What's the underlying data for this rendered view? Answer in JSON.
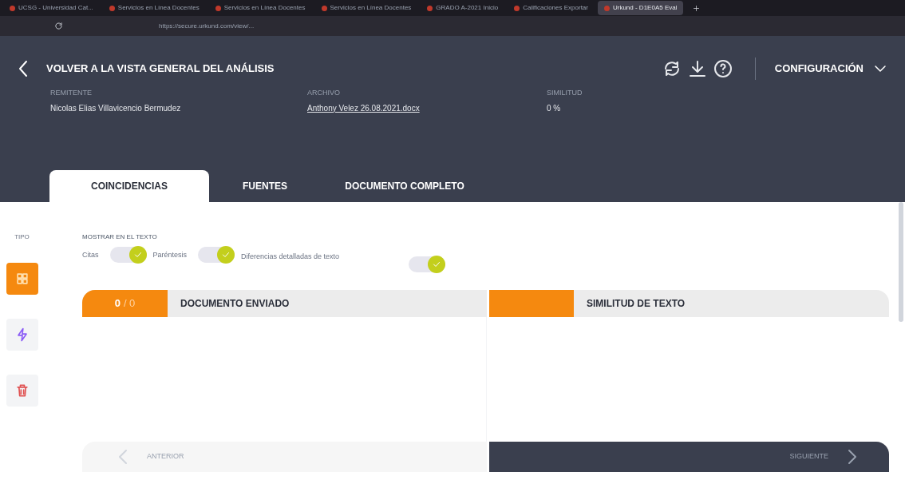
{
  "browser": {
    "tabs": [
      {
        "title": "UCSG - Universidad Cat...",
        "selected": false
      },
      {
        "title": "Servicios en Línea Docentes",
        "selected": false
      },
      {
        "title": "Servicios en Línea Docentes",
        "selected": false
      },
      {
        "title": "Servicios en Línea Docentes",
        "selected": false
      },
      {
        "title": "GRADO A-2021 Inicio",
        "selected": false
      },
      {
        "title": "Calificaciones Exportar",
        "selected": false
      },
      {
        "title": "Urkund - D1E0A5 Eval",
        "selected": true
      }
    ],
    "url": "https://secure.urkund.com/view/..."
  },
  "header": {
    "back_label": "VOLVER A LA VISTA GENERAL DEL ANÁLISIS",
    "settings_label": "CONFIGURACIÓN",
    "meta": [
      {
        "label": "REMITENTE",
        "value": "Nicolas Elias Villavicencio Bermudez",
        "kind": "text"
      },
      {
        "label": "ARCHIVO",
        "value": "Anthony Velez 26.08.2021.docx",
        "kind": "link"
      },
      {
        "label": "SIMILITUD",
        "value": "0 %",
        "kind": "text"
      }
    ]
  },
  "tabs": [
    {
      "label": "COINCIDENCIAS",
      "selected": true
    },
    {
      "label": "FUENTES",
      "selected": false
    },
    {
      "label": "DOCUMENTO COMPLETO",
      "selected": false
    }
  ],
  "sidebar": {
    "label": "TIPO",
    "items": [
      {
        "kind": "grid",
        "selected": true
      },
      {
        "kind": "bolt",
        "selected": false
      },
      {
        "kind": "trash",
        "selected": false
      }
    ]
  },
  "options": {
    "label": "MOSTRAR EN EL TEXTO",
    "toggles": [
      {
        "label": "Citas",
        "on": true
      },
      {
        "label": "Paréntesis",
        "on": true
      },
      {
        "label": "Diferencias detalladas de texto",
        "on": true
      }
    ]
  },
  "panels": {
    "counter_current": "0",
    "counter_total": "/ 0",
    "left_title": "DOCUMENTO ENVIADO",
    "right_title": "SIMILITUD DE TEXTO"
  },
  "nav": {
    "previous": "ANTERIOR",
    "next": "SIGUIENTE"
  }
}
